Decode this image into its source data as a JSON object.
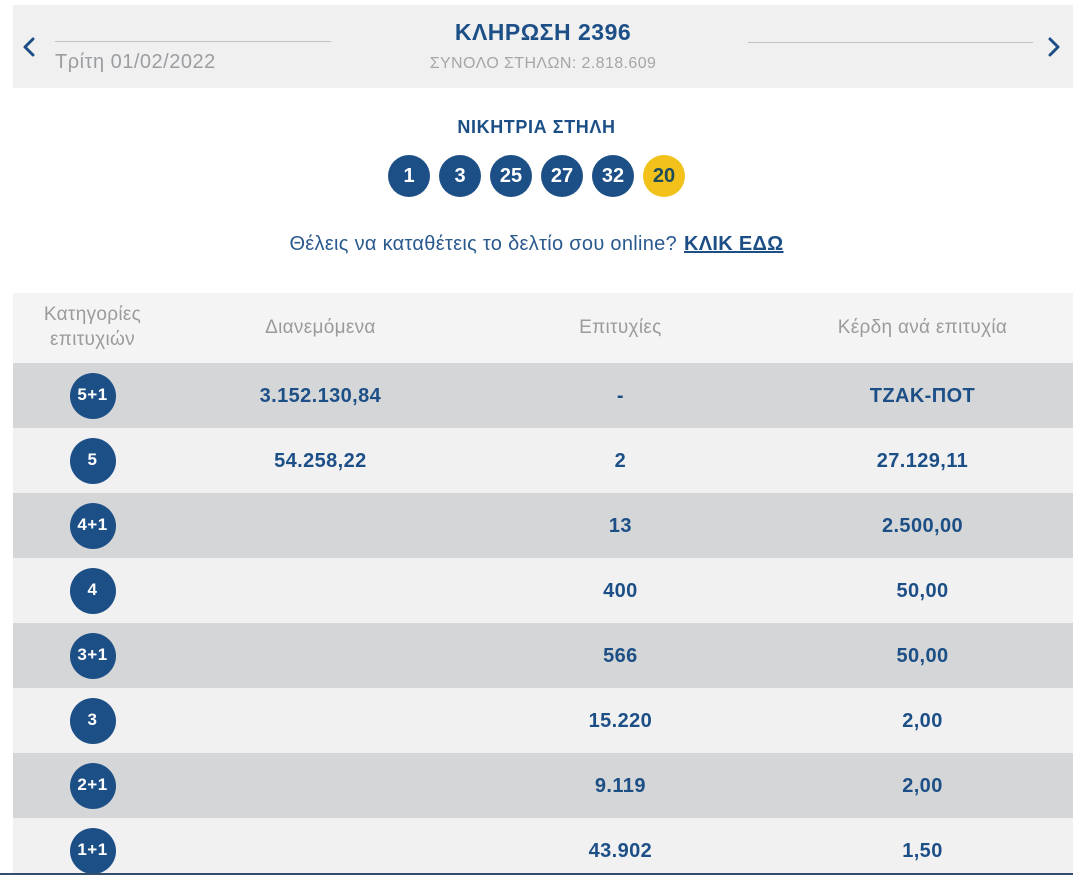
{
  "header": {
    "date": "Τρίτη 01/02/2022",
    "title": "ΚΛΗΡΩΣΗ 2396",
    "subtitle": "ΣΥΝΟΛΟ ΣΤΗΛΩΝ: 2.818.609"
  },
  "winning": {
    "heading": "ΝΙΚΗΤΡΙΑ ΣΤΗΛΗ",
    "numbers": [
      "1",
      "3",
      "25",
      "27",
      "32"
    ],
    "joker": "20"
  },
  "cta": {
    "text": "Θέλεις να καταθέτεις το δελτίο σου online?",
    "link_label": "ΚΛΙΚ ΕΔΩ"
  },
  "table": {
    "headers": [
      "Κατηγορίες επιτυχιών",
      "Διανεμόμενα",
      "Επιτυχίες",
      "Κέρδη ανά επιτυχία"
    ],
    "rows": [
      {
        "category": "5+1",
        "distributed": "3.152.130,84",
        "winners": "-",
        "prize": "ΤΖΑΚ-ΠΟΤ"
      },
      {
        "category": "5",
        "distributed": "54.258,22",
        "winners": "2",
        "prize": "27.129,11"
      },
      {
        "category": "4+1",
        "distributed": "",
        "winners": "13",
        "prize": "2.500,00"
      },
      {
        "category": "4",
        "distributed": "",
        "winners": "400",
        "prize": "50,00"
      },
      {
        "category": "3+1",
        "distributed": "",
        "winners": "566",
        "prize": "50,00"
      },
      {
        "category": "3",
        "distributed": "",
        "winners": "15.220",
        "prize": "2,00"
      },
      {
        "category": "2+1",
        "distributed": "",
        "winners": "9.119",
        "prize": "2,00"
      },
      {
        "category": "1+1",
        "distributed": "",
        "winners": "43.902",
        "prize": "1,50"
      }
    ]
  },
  "colors": {
    "navy": "#1d4f87",
    "gold": "#f2c11c",
    "gold_ball_text": "#1d4d5a",
    "row_light": "#f1f1f2",
    "row_dark": "#d5d6d8",
    "header_bg": "#f0f0f1",
    "muted_text": "#9b9b9d"
  }
}
